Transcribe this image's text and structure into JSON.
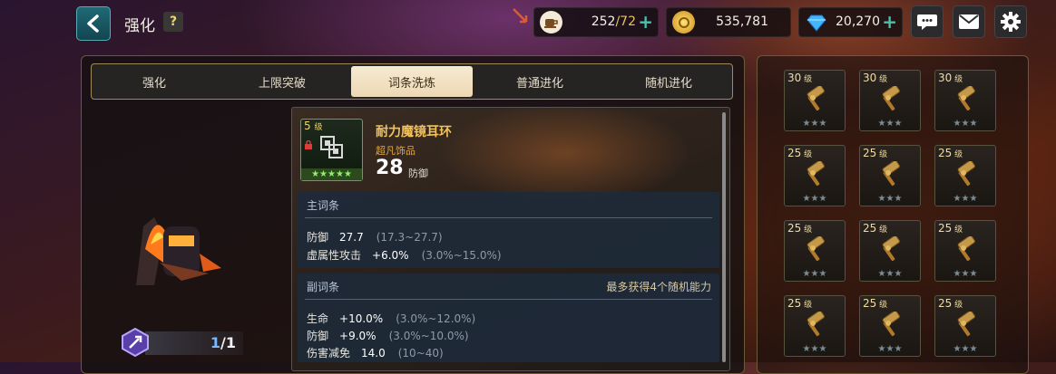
{
  "header": {
    "title": "强化",
    "help": "?",
    "resources": [
      {
        "name": "stamina",
        "icon": "coffee-cup-icon",
        "value": "252",
        "max": "72"
      },
      {
        "name": "gold",
        "icon": "gold-coin-icon",
        "value": "535,781"
      },
      {
        "name": "gems",
        "icon": "diamond-icon",
        "value": "20,270"
      }
    ],
    "buttons": [
      "chat-icon",
      "mail-icon",
      "settings-icon"
    ]
  },
  "tabs": [
    {
      "label": "强化",
      "active": false
    },
    {
      "label": "上限突破",
      "active": false
    },
    {
      "label": "词条洗炼",
      "active": true
    },
    {
      "label": "普通进化",
      "active": false
    },
    {
      "label": "随机进化",
      "active": false
    }
  ],
  "hero": {
    "count": "1",
    "total": "1"
  },
  "item": {
    "level": "5",
    "level_unit": "级",
    "stars": "★★★★★",
    "name": "耐力魔镜耳环",
    "rarity": "超凡饰品",
    "stat_value": "28",
    "stat_name": "防御"
  },
  "main_stats": {
    "title": "主词条",
    "rows": [
      {
        "name": "防御",
        "value": "27.7",
        "range": "(17.3~27.7)"
      },
      {
        "name": "虚属性攻击",
        "value": "+6.0%",
        "range": "(3.0%~15.0%)"
      }
    ]
  },
  "sub_stats": {
    "title": "副词条",
    "note": "最多获得4个随机能力",
    "rows": [
      {
        "name": "生命",
        "value": "+10.0%",
        "range": "(3.0%~12.0%)"
      },
      {
        "name": "防御",
        "value": "+9.0%",
        "range": "(3.0%~10.0%)"
      },
      {
        "name": "伤害减免",
        "value": "14.0",
        "range": "(10~40)"
      }
    ]
  },
  "inventory": [
    {
      "level": "30",
      "unit": "级",
      "stars": "★★★"
    },
    {
      "level": "30",
      "unit": "级",
      "stars": "★★★"
    },
    {
      "level": "30",
      "unit": "级",
      "stars": "★★★"
    },
    {
      "level": "25",
      "unit": "级",
      "stars": "★★★"
    },
    {
      "level": "25",
      "unit": "级",
      "stars": "★★★"
    },
    {
      "level": "25",
      "unit": "级",
      "stars": "★★★"
    },
    {
      "level": "25",
      "unit": "级",
      "stars": "★★★"
    },
    {
      "level": "25",
      "unit": "级",
      "stars": "★★★"
    },
    {
      "level": "25",
      "unit": "级",
      "stars": "★★★"
    },
    {
      "level": "25",
      "unit": "级",
      "stars": "★★★"
    },
    {
      "level": "25",
      "unit": "级",
      "stars": "★★★"
    },
    {
      "level": "25",
      "unit": "级",
      "stars": "★★★"
    }
  ],
  "colors": {
    "accent": "#f2c15a",
    "active_tab": "#f3e3c4",
    "teal": "#1f6a76"
  }
}
